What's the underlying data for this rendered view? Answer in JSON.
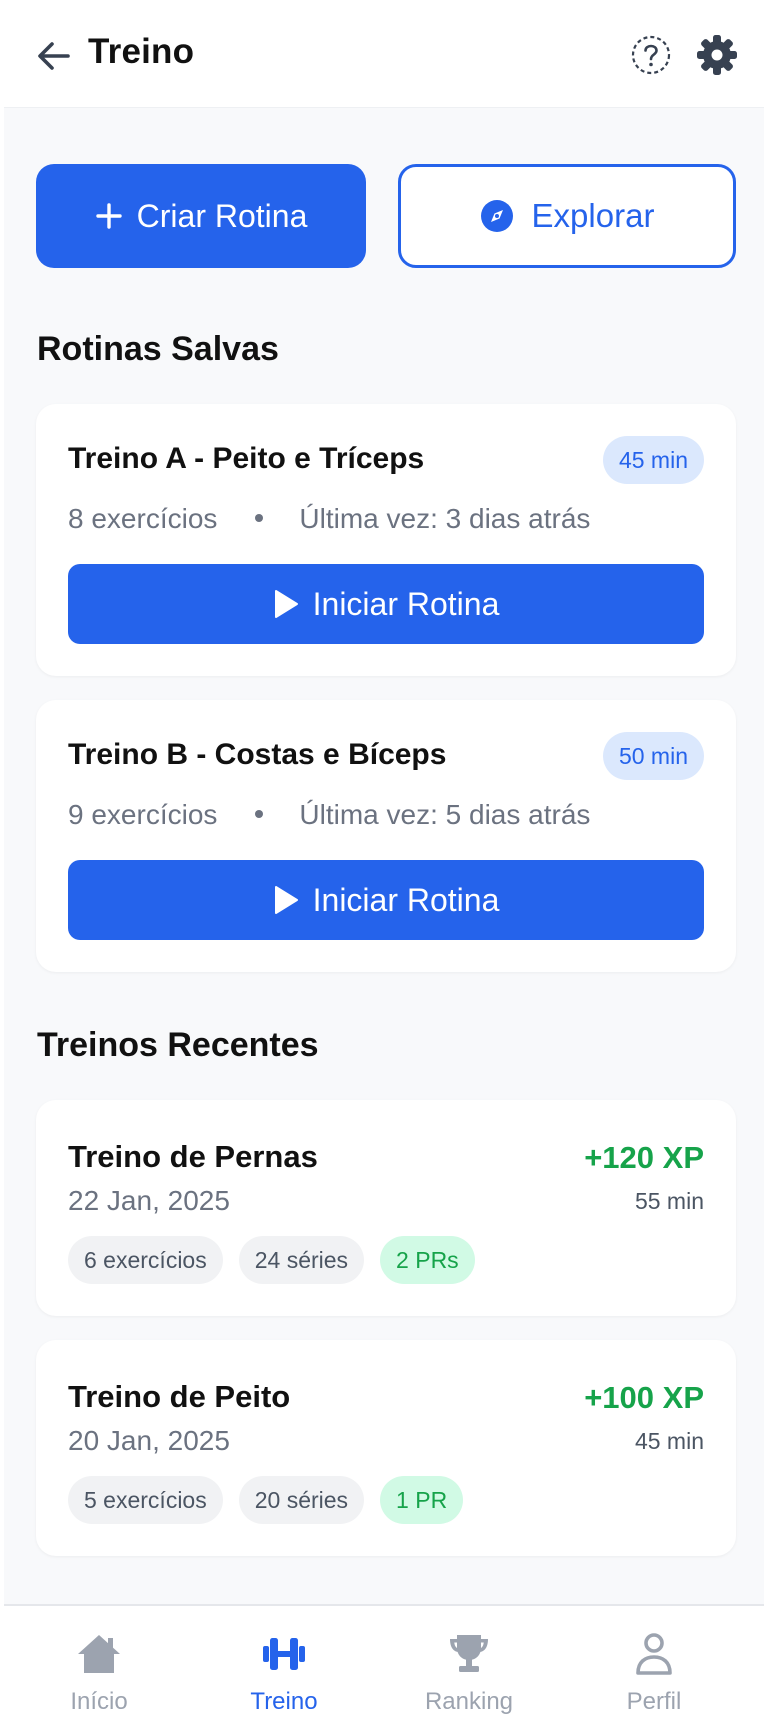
{
  "header": {
    "title": "Treino"
  },
  "actions": {
    "create_label": "Criar Rotina",
    "explore_label": "Explorar"
  },
  "saved_section_title": "Rotinas Salvas",
  "routines": [
    {
      "name": "Treino A - Peito e Tríceps",
      "duration": "45 min",
      "exercises": "8 exercícios",
      "last": "Última vez: 3 dias atrás",
      "start_label": "Iniciar Rotina"
    },
    {
      "name": "Treino B - Costas e Bíceps",
      "duration": "50 min",
      "exercises": "9 exercícios",
      "last": "Última vez: 5 dias atrás",
      "start_label": "Iniciar Rotina"
    }
  ],
  "recent_section_title": "Treinos Recentes",
  "workouts": [
    {
      "name": "Treino de Pernas",
      "date": "22 Jan, 2025",
      "xp": "+120 XP",
      "minutes": "55 min",
      "exercises": "6 exercícios",
      "series": "24 séries",
      "prs": "2 PRs"
    },
    {
      "name": "Treino de Peito",
      "date": "20 Jan, 2025",
      "xp": "+100 XP",
      "minutes": "45 min",
      "exercises": "5 exercícios",
      "series": "20 séries",
      "prs": "1 PR"
    }
  ],
  "nav": {
    "items": [
      {
        "label": "Início"
      },
      {
        "label": "Treino"
      },
      {
        "label": "Ranking"
      },
      {
        "label": "Perfil"
      }
    ],
    "active": "Treino"
  },
  "colors": {
    "primary": "#2563eb",
    "success": "#16a34a",
    "muted": "#6b7280",
    "badge_bg": "#dbe8fd",
    "pr_bg": "#d1fae5"
  }
}
